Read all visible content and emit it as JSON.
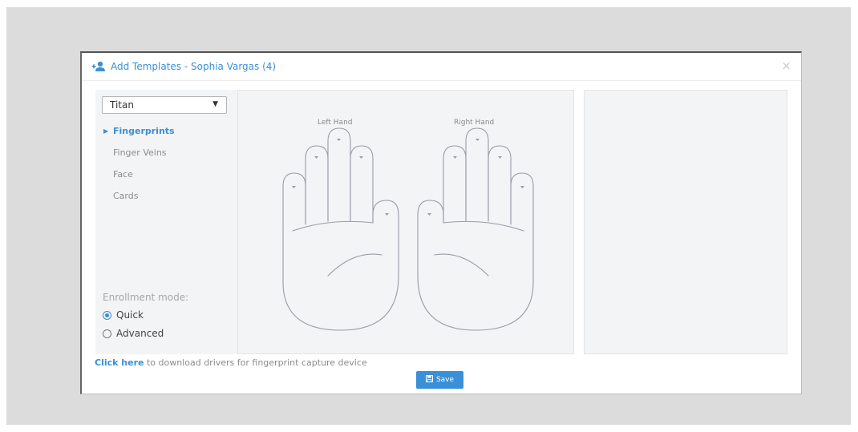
{
  "dialog": {
    "title": "Add Templates - Sophia Vargas (4)",
    "close_symbol": "×",
    "title_icon": "add-user-icon",
    "accent_color": "#3a8fd6"
  },
  "device_select": {
    "selected": "Titan",
    "caret": "▼"
  },
  "nav": {
    "items": [
      {
        "label": "Fingerprints",
        "active": true
      },
      {
        "label": "Finger Veins",
        "active": false
      },
      {
        "label": "Face",
        "active": false
      },
      {
        "label": "Cards",
        "active": false
      }
    ],
    "active_marker": "▶"
  },
  "enrollment": {
    "label": "Enrollment mode:",
    "options": [
      {
        "label": "Quick",
        "selected": true
      },
      {
        "label": "Advanced",
        "selected": false
      }
    ]
  },
  "hands": {
    "left_label": "Left Hand",
    "right_label": "Right Hand"
  },
  "footer": {
    "link_text": "Click here",
    "rest_text": " to download drivers for fingerprint capture device"
  },
  "save_button": {
    "label": "Save",
    "icon": "floppy-disk-icon"
  }
}
